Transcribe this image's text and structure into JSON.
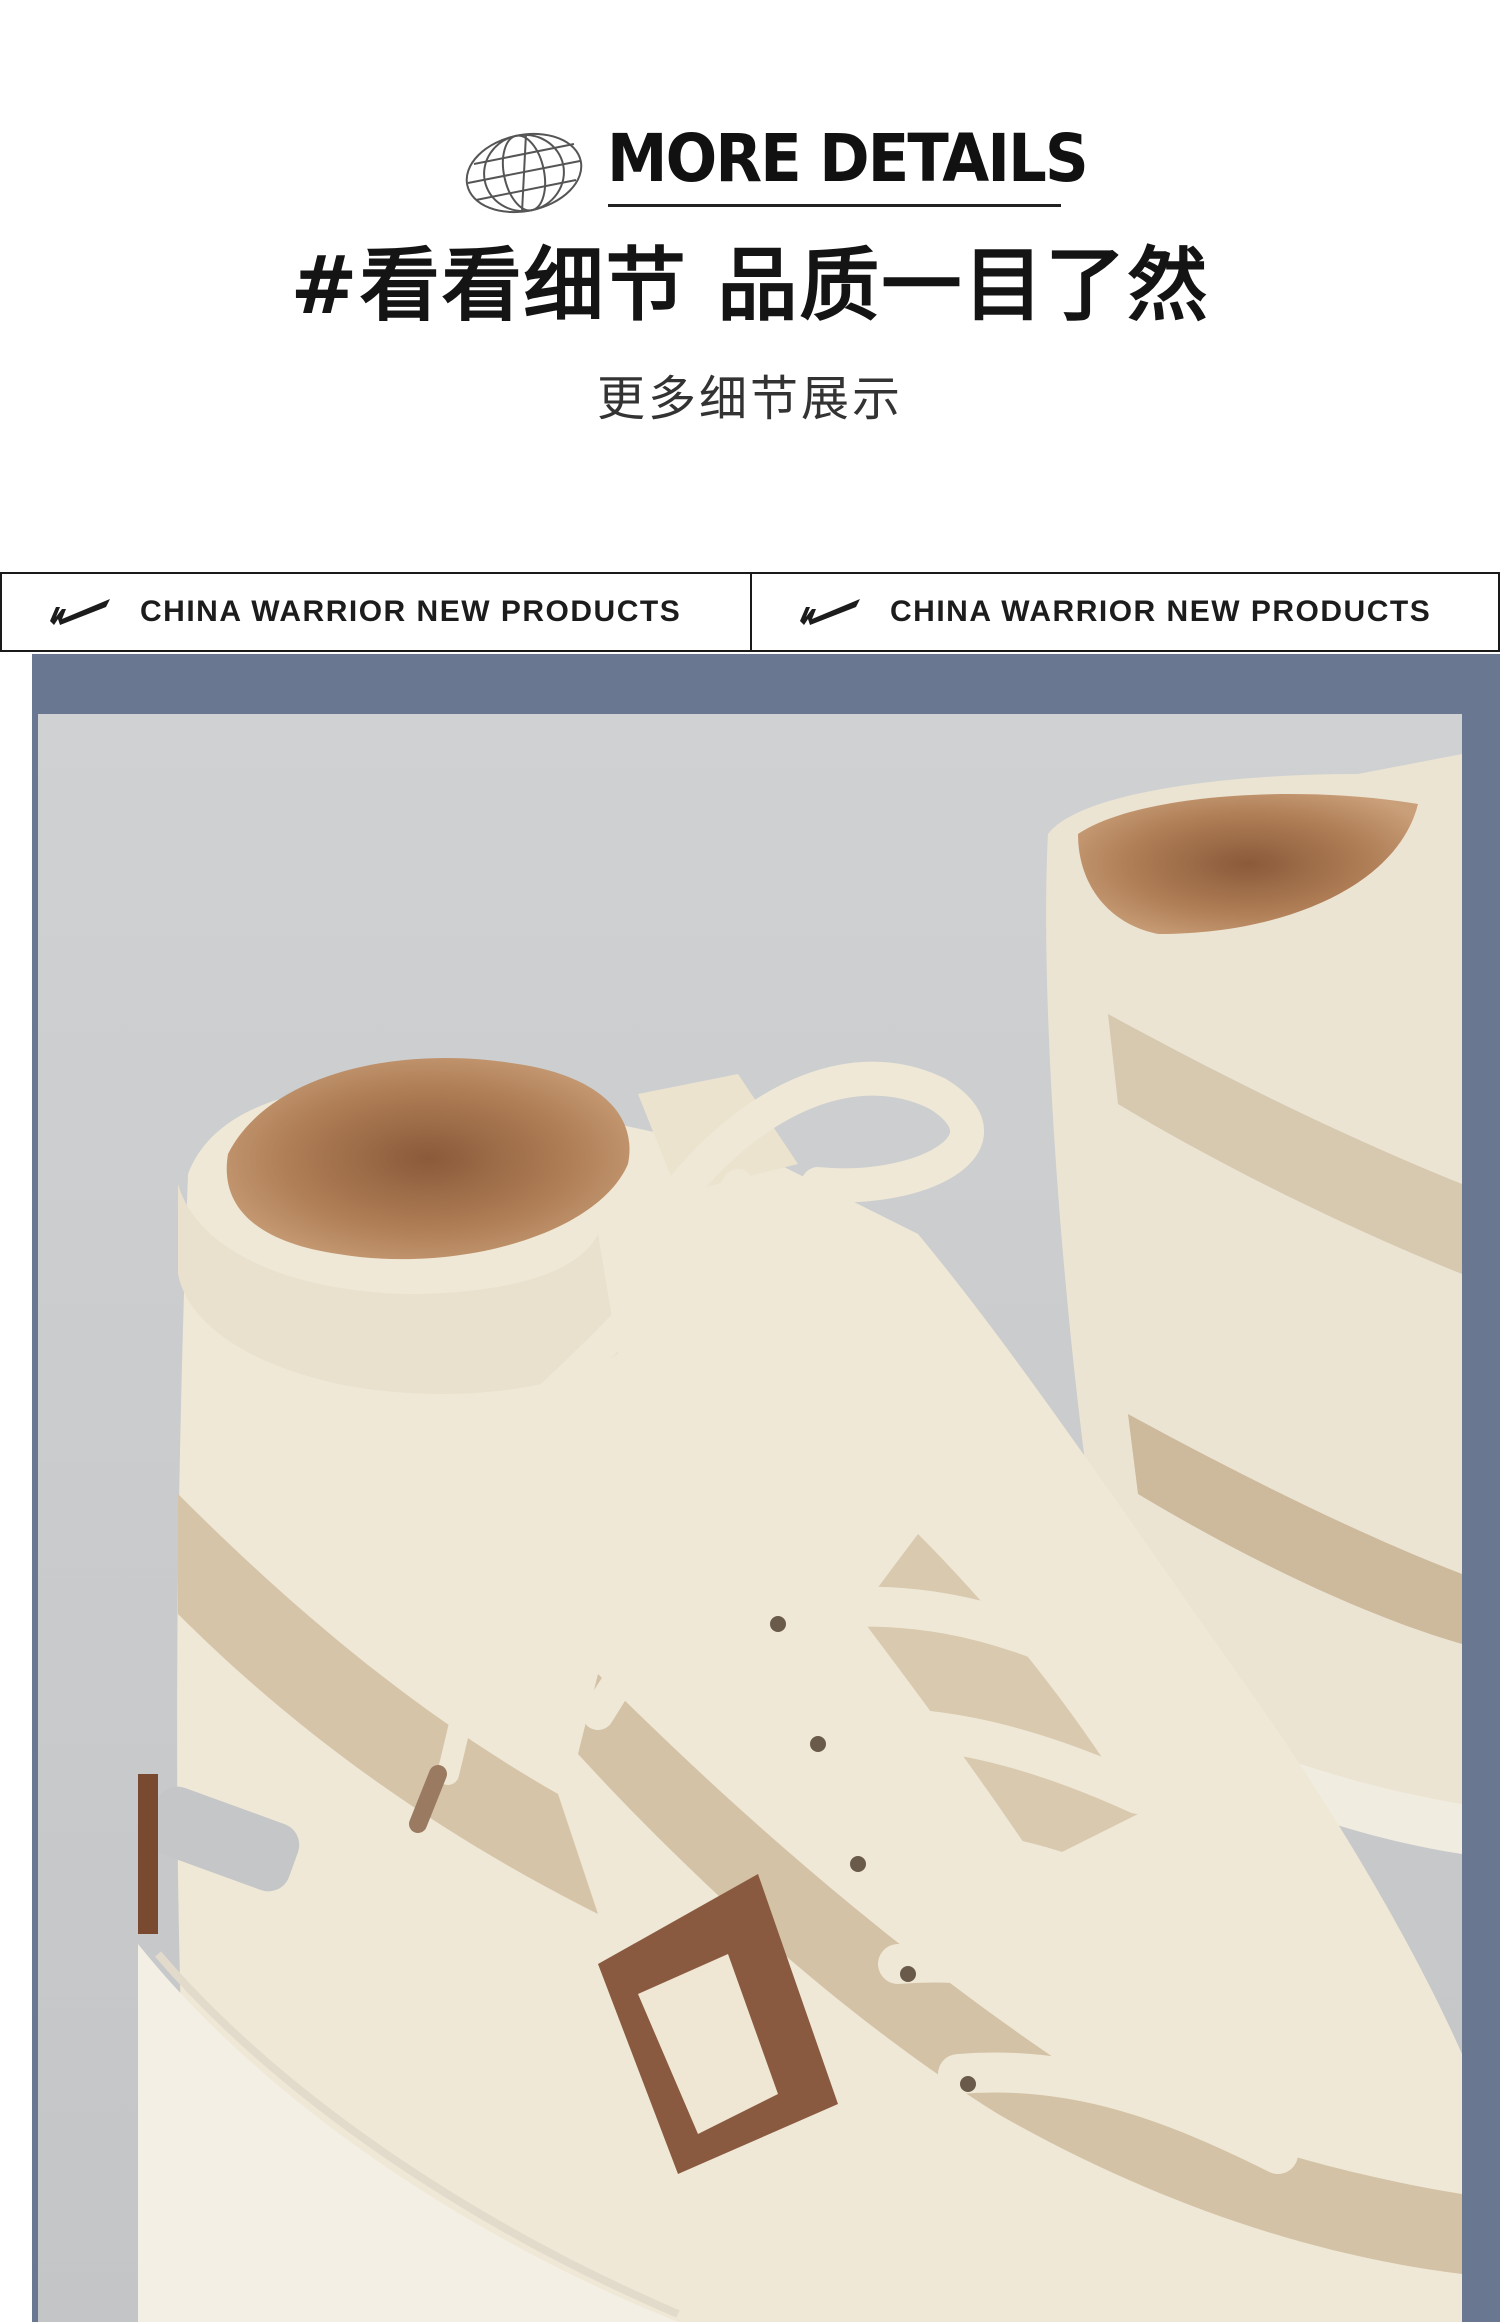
{
  "header": {
    "globe_icon": "globe-icon",
    "title_en": "MORE DETAILS",
    "headline_cn": "#看看细节 品质一目了然",
    "subline_cn": "更多细节展示"
  },
  "banners": [
    {
      "logo_icon": "warrior-swoosh-logo",
      "text": "CHINA WARRIOR NEW PRODUCTS"
    },
    {
      "logo_icon": "warrior-swoosh-logo",
      "text": "CHINA WARRIOR NEW PRODUCTS"
    }
  ],
  "photo": {
    "subject": "high-top-sneaker-closeup",
    "frame_color": "#6a7791",
    "background_color": "#c9cbcd"
  }
}
